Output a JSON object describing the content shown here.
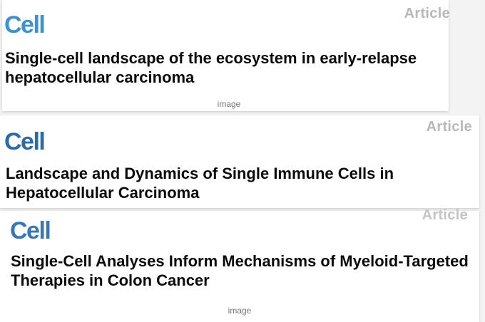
{
  "cards": [
    {
      "journal": "Cell",
      "type": "Article",
      "title": "Single-cell landscape of the ecosystem in early-relapse hepatocellular carcinoma",
      "caption": "image"
    },
    {
      "journal": "Cell",
      "type": "Article",
      "title": "Landscape and Dynamics of Single Immune Cells in Hepatocellular Carcinoma"
    },
    {
      "journal": "Cell",
      "type": "Article",
      "title": "Single-Cell Analyses Inform Mechanisms of Myeloid-Targeted Therapies in Colon Cancer",
      "caption": "image"
    }
  ]
}
